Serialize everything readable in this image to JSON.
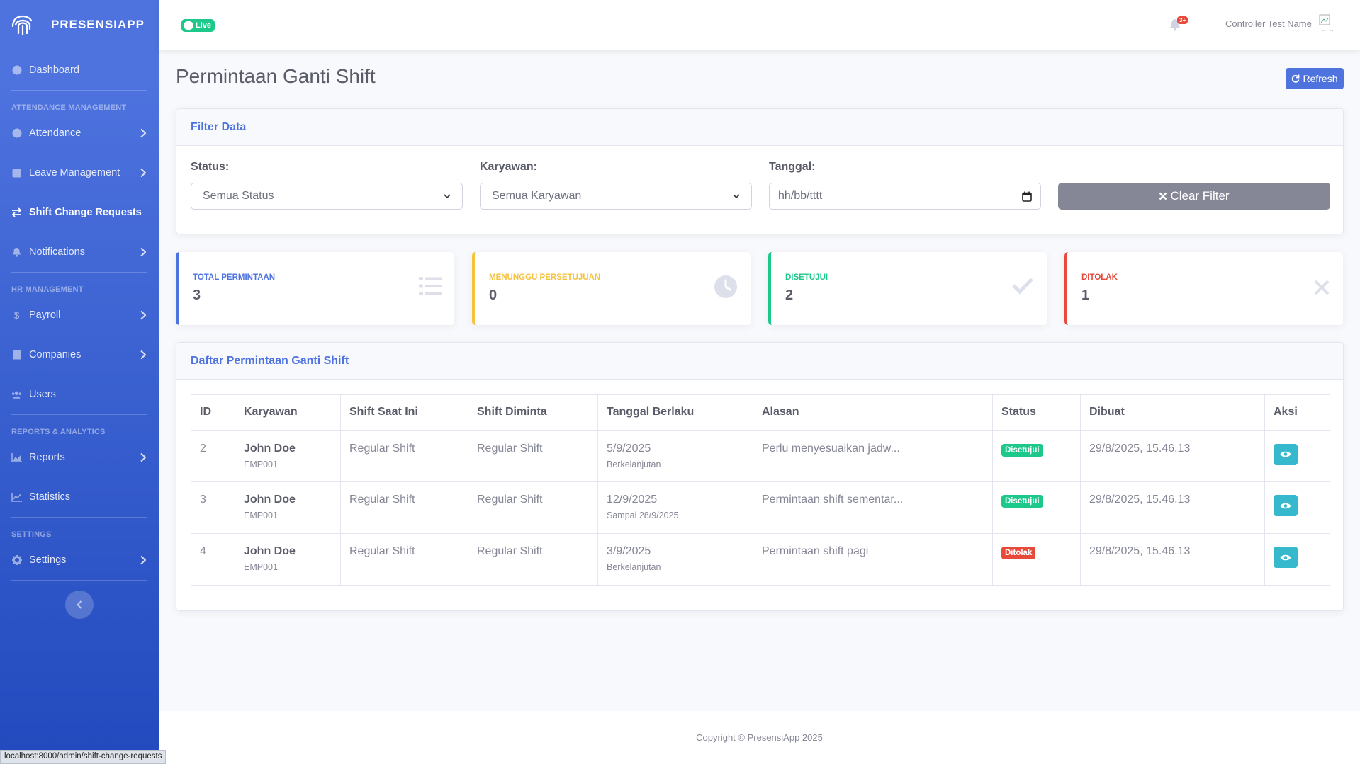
{
  "brand": {
    "name": "PRESENSIAPP"
  },
  "sidebar": {
    "items": [
      {
        "label": "Dashboard"
      },
      {
        "heading": "ATTENDANCE MANAGEMENT"
      },
      {
        "label": "Attendance"
      },
      {
        "label": "Leave Management"
      },
      {
        "label": "Shift Change Requests"
      },
      {
        "label": "Notifications"
      },
      {
        "heading": "HR MANAGEMENT"
      },
      {
        "label": "Payroll"
      },
      {
        "label": "Companies"
      },
      {
        "label": "Users"
      },
      {
        "heading": "REPORTS & ANALYTICS"
      },
      {
        "label": "Reports"
      },
      {
        "label": "Statistics"
      },
      {
        "heading": "SETTINGS"
      },
      {
        "label": "Settings"
      }
    ],
    "active": "Shift Change Requests"
  },
  "topbar": {
    "live_label": "Live",
    "notif_badge": "3+",
    "user_name": "Controller Test Name"
  },
  "page": {
    "title": "Permintaan Ganti Shift",
    "refresh_label": "Refresh"
  },
  "filter": {
    "title": "Filter Data",
    "status_label": "Status:",
    "status_value": "Semua Status",
    "employee_label": "Karyawan:",
    "employee_value": "Semua Karyawan",
    "date_label": "Tanggal:",
    "date_placeholder": "hh/bb/tttt",
    "clear_label": "Clear Filter"
  },
  "stats": [
    {
      "label": "TOTAL PERMINTAAN",
      "value": "3",
      "color": "#4e73df"
    },
    {
      "label": "MENUNGGU PERSETUJUAN",
      "value": "0",
      "color": "#f6c23e"
    },
    {
      "label": "DISETUJUI",
      "value": "2",
      "color": "#1cc88a"
    },
    {
      "label": "DITOLAK",
      "value": "1",
      "color": "#e74a3b"
    }
  ],
  "table": {
    "title": "Daftar Permintaan Ganti Shift",
    "headers": [
      "ID",
      "Karyawan",
      "Shift Saat Ini",
      "Shift Diminta",
      "Tanggal Berlaku",
      "Alasan",
      "Status",
      "Dibuat",
      "Aksi"
    ],
    "rows": [
      {
        "id": "2",
        "name": "John Doe",
        "emp": "EMP001",
        "current": "Regular Shift",
        "requested": "Regular Shift",
        "date": "5/9/2025",
        "date_sub": "Berkelanjutan",
        "reason": "Perlu menyesuaikan jadw...",
        "status": "Disetujui",
        "status_color": "#1cc88a",
        "created": "29/8/2025, 15.46.13"
      },
      {
        "id": "3",
        "name": "John Doe",
        "emp": "EMP001",
        "current": "Regular Shift",
        "requested": "Regular Shift",
        "date": "12/9/2025",
        "date_sub": "Sampai 28/9/2025",
        "reason": "Permintaan shift sementar...",
        "status": "Disetujui",
        "status_color": "#1cc88a",
        "created": "29/8/2025, 15.46.13"
      },
      {
        "id": "4",
        "name": "John Doe",
        "emp": "EMP001",
        "current": "Regular Shift",
        "requested": "Regular Shift",
        "date": "3/9/2025",
        "date_sub": "Berkelanjutan",
        "reason": "Permintaan shift pagi",
        "status": "Ditolak",
        "status_color": "#e74a3b",
        "created": "29/8/2025, 15.46.13"
      }
    ]
  },
  "footer": {
    "text": "Copyright © PresensiApp 2025"
  },
  "status_bar": {
    "url": "localhost:8000/admin/shift-change-requests"
  }
}
